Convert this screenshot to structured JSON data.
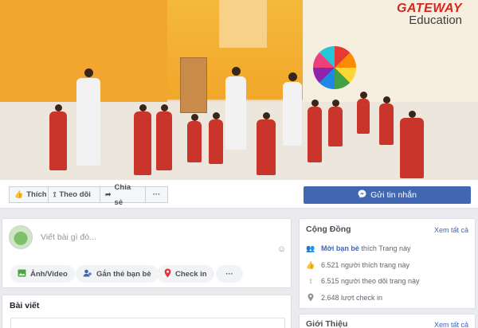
{
  "cover": {
    "logo_line1": "GATEWAY",
    "logo_line2": "Education"
  },
  "actions": {
    "like": "Thích",
    "follow": "Theo dõi",
    "share": "Chia sẻ",
    "more": "···",
    "message": "Gửi tin nhắn"
  },
  "composer": {
    "placeholder": "Viết bài gì đó...",
    "photo_video": "Ảnh/Video",
    "tag_friends": "Gắn thẻ bạn bè",
    "check_in": "Check in",
    "more": "···"
  },
  "posts": {
    "title": "Bài viết"
  },
  "community": {
    "title": "Cộng Đồng",
    "see_all": "Xem tất cả",
    "invite_link": "Mời bạn bè",
    "invite_rest": "thích Trang này",
    "likes": "6.521 người thích trang này",
    "follows": "6.515 người theo dõi trang này",
    "checkins": "2.648 lượt check in"
  },
  "about": {
    "title": "Giới Thiệu",
    "see_all": "Xem tất cả"
  },
  "colors": {
    "brand_blue": "#4267b2",
    "logo_red": "#d6261d"
  }
}
